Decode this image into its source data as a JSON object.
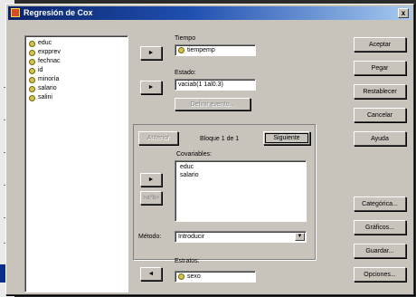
{
  "window": {
    "title": "Regresión de Cox",
    "close_label": "x"
  },
  "variables": [
    {
      "name": "educ"
    },
    {
      "name": "expprev"
    },
    {
      "name": "fechnac"
    },
    {
      "name": "id"
    },
    {
      "name": "minoría"
    },
    {
      "name": "salario"
    },
    {
      "name": "salini"
    }
  ],
  "tiempo": {
    "label": "Tiempo",
    "value": "tiempemp",
    "arrow": "►"
  },
  "estado": {
    "label": "Estado:",
    "value": "vaciab(1 1al0.3)",
    "arrow": "►",
    "define_button": "Definir evento..."
  },
  "block": {
    "prev_button": "Anterior",
    "status": "Bloque 1 de 1",
    "next_button": "Siguiente"
  },
  "covariables": {
    "label": "Covariables:",
    "items": [
      "educ",
      "salario"
    ],
    "arrow": "►",
    "interaction_button": ">a*b>"
  },
  "metodo": {
    "label": "Método:",
    "value": "Introducir",
    "dropdown_glyph": "▼"
  },
  "estratos": {
    "label": "Estratos:",
    "value": "sexo",
    "arrow": "◄"
  },
  "buttons": {
    "aceptar": "Aceptar",
    "pegar": "Pegar",
    "restablecer": "Restablecer",
    "cancelar": "Cancelar",
    "ayuda": "Ayuda",
    "categorica": "Categórica...",
    "graficos": "Gráficos...",
    "guardar": "Guardar...",
    "opciones": "Opciones..."
  }
}
